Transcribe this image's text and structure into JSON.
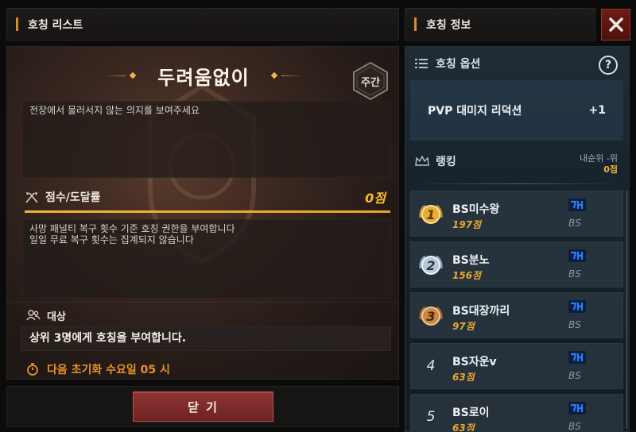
{
  "left_header": {
    "title": "호칭 리스트"
  },
  "right_header": {
    "title": "호칭 정보"
  },
  "title_detail": {
    "name": "두려움없이",
    "period_badge": "주간",
    "description": "전장에서 물러서지 않는 의지를 보여주세요",
    "score_label": "점수/도달률",
    "score_value": "0점",
    "progress_fraction": 1.0,
    "condition_lines": [
      "사망 패널티 복구 횟수 기준 호칭 권한을 부여합니다",
      "일일 무료 복구 횟수는 집계되지 않습니다"
    ],
    "target_label": "대상",
    "target_text": "상위 3명에게 호칭을 부여합니다.",
    "reset_text": "다음 초기화 수요일 05 시"
  },
  "buttons": {
    "close_main": "닫 기",
    "help": "?"
  },
  "options": {
    "label": "호칭 옵션",
    "name": "PVP 대미지 리덕션",
    "value": "+1"
  },
  "ranking": {
    "label": "랭킹",
    "my_rank_label": "내순위 -위",
    "my_rank_score": "0점",
    "entries": [
      {
        "rank": "1",
        "name": "BS미수왕",
        "score": "197점",
        "guild": "BS",
        "medal": "gold"
      },
      {
        "rank": "2",
        "name": "BS분노",
        "score": "156점",
        "guild": "BS",
        "medal": "silver"
      },
      {
        "rank": "3",
        "name": "BS대장까리",
        "score": "97점",
        "guild": "BS",
        "medal": "bronze"
      },
      {
        "rank": "4",
        "name": "BS자운v",
        "score": "63점",
        "guild": "BS",
        "medal": "none"
      },
      {
        "rank": "5",
        "name": "BS로이",
        "score": "63점",
        "guild": "BS",
        "medal": "none"
      }
    ]
  },
  "colors": {
    "accent_gold": "#ffba2d",
    "accent_orange": "#e8932a",
    "close_red": "#6e1b12",
    "server_blue": "#1f6dff"
  }
}
